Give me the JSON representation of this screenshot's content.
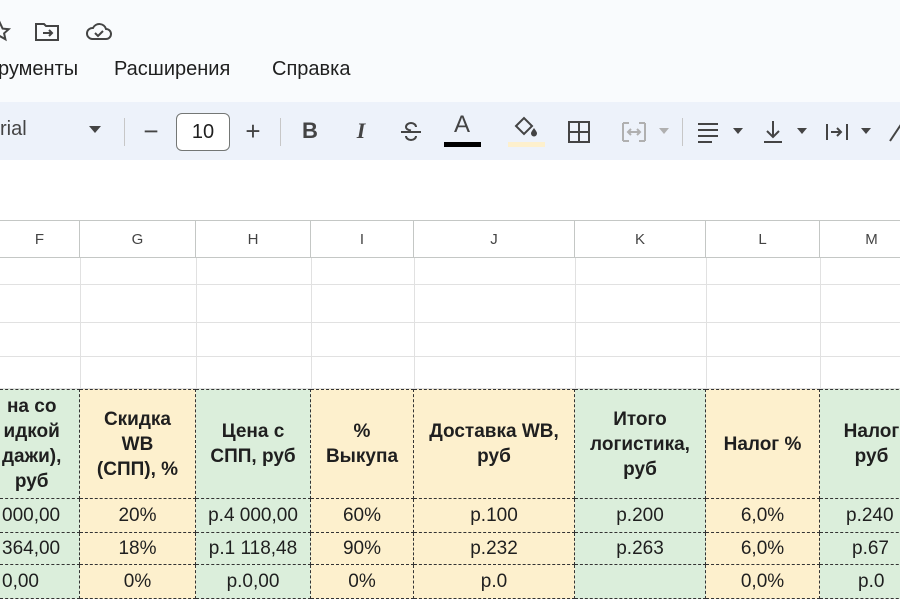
{
  "toolbar_icons": {
    "star": "star-icon",
    "move": "move-to-folder-icon",
    "cloud": "cloud-saved-icon"
  },
  "menu": {
    "items": [
      "рументы",
      "Расширения",
      "Справка"
    ]
  },
  "toolbar": {
    "font_name": "rial",
    "font_size": "10",
    "minus": "−",
    "plus": "+",
    "bold": "B",
    "italic": "I",
    "text_color_letter": "A",
    "text_color": "#000000",
    "fill_color": "#fdf0cd"
  },
  "columns": [
    "F",
    "G",
    "H",
    "I",
    "J",
    "K",
    "L",
    "M"
  ],
  "table": {
    "headers": [
      "на со\nидкой\nдажи),\nруб",
      "Скидка\nWB\n(СПП), %",
      "Цена с\nСПП, руб",
      "%\nВыкупа",
      "Доставка WB,\nруб",
      "Итого\nлогистика,\nруб",
      "Налог %",
      "Налог\nруб"
    ],
    "rows": [
      [
        "000,00",
        "20%",
        "р.4 000,00",
        "60%",
        "р.100",
        "р.200",
        "6,0%",
        "р.240"
      ],
      [
        "364,00",
        "18%",
        "р.1 118,48",
        "90%",
        "р.232",
        "р.263",
        "6,0%",
        "р.67"
      ],
      [
        "0,00",
        "0%",
        "р.0,00",
        "0%",
        "р.0",
        "",
        "0,0%",
        "р.0"
      ]
    ]
  },
  "colors": {
    "green_fill": "#dbeedb",
    "yellow_fill": "#fdf0cd",
    "toolbar_bg": "#edf2fa"
  }
}
